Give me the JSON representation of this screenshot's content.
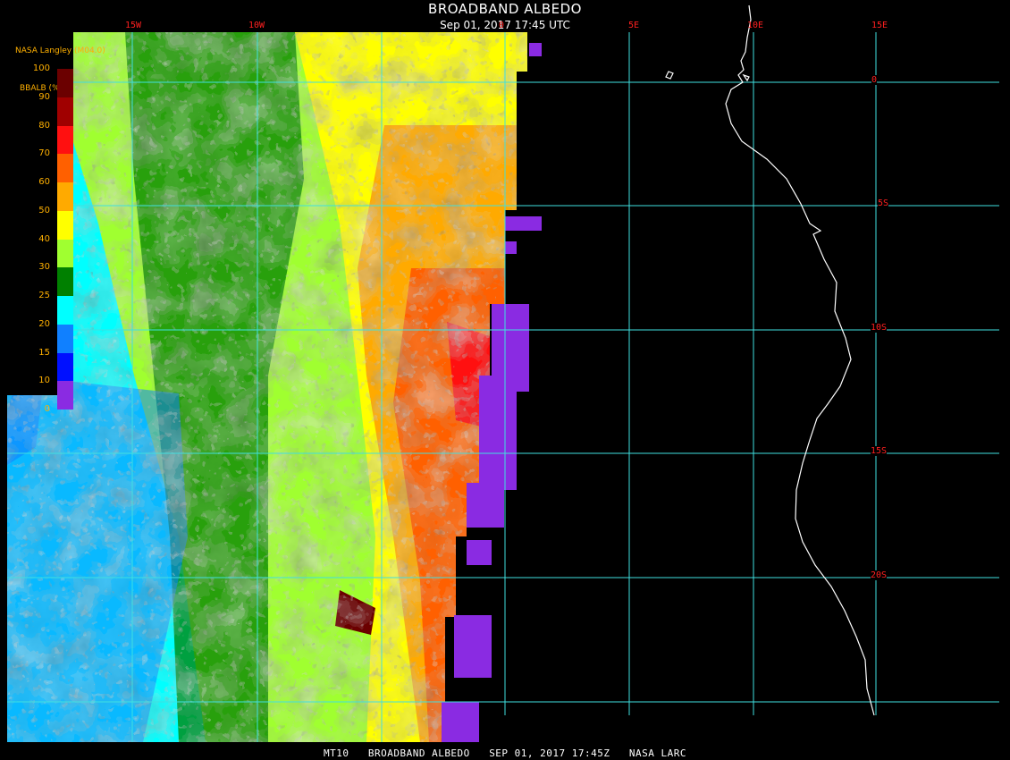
{
  "header": {
    "title": "BROADBAND ALBEDO",
    "subtitle": "Sep 01, 2017 17:45 UTC"
  },
  "footer": {
    "product": "MT10",
    "name": "BROADBAND ALBEDO",
    "datetime": "SEP 01, 2017 17:45Z",
    "org": "NASA LARC"
  },
  "legend": {
    "producer": "NASA Langley (M04.0)",
    "unit_label": "BBALB (%)",
    "ticks": [
      "100",
      "90",
      "80",
      "70",
      "60",
      "50",
      "40",
      "30",
      "25",
      "20",
      "15",
      "10",
      "0"
    ],
    "colors": [
      "#6b0000",
      "#a00000",
      "#ff1010",
      "#ff6000",
      "#ffaa00",
      "#ffff00",
      "#a0ff30",
      "#008000",
      "#00ffff",
      "#1080ff",
      "#0010ff",
      "#8a2be2"
    ]
  },
  "map": {
    "longitude_labels": [
      "15W",
      "10W",
      "0",
      "5E",
      "10E",
      "15E"
    ],
    "latitude_labels": [
      "0",
      "5S",
      "10S",
      "15S",
      "20S"
    ],
    "colors": {
      "background": "#000000",
      "gridline": "#40e0e0",
      "coastline": "#ffffff",
      "grid_label": "#ff2020",
      "no_data": "#8a2be2"
    }
  }
}
